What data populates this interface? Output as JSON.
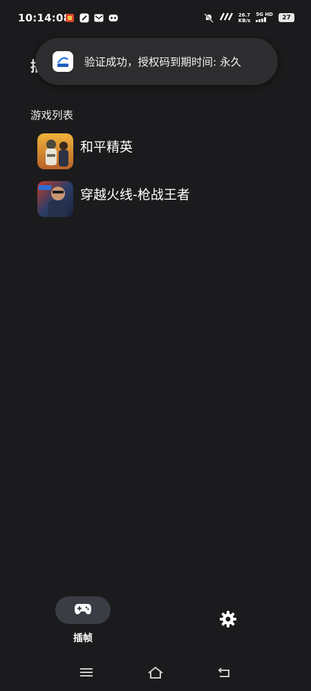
{
  "status_bar": {
    "time": "10:14:08",
    "speed_value": "26.7",
    "speed_unit": "KB/s",
    "network_type": "5G HD",
    "battery_level": "27"
  },
  "page_title_peek": "插",
  "toast": {
    "message": "验证成功，授权码到期时间: 永久"
  },
  "game_list": {
    "section_title": "游戏列表",
    "items": [
      {
        "name": "和平精英"
      },
      {
        "name": "穿越火线-枪战王者"
      }
    ]
  },
  "bottom_tabs": {
    "frame_label": "插帧",
    "active_tab": "frame"
  },
  "colors": {
    "background": "#1b1b1d",
    "toast_bg": "#2d2d30",
    "active_pill": "#3a3d44"
  }
}
